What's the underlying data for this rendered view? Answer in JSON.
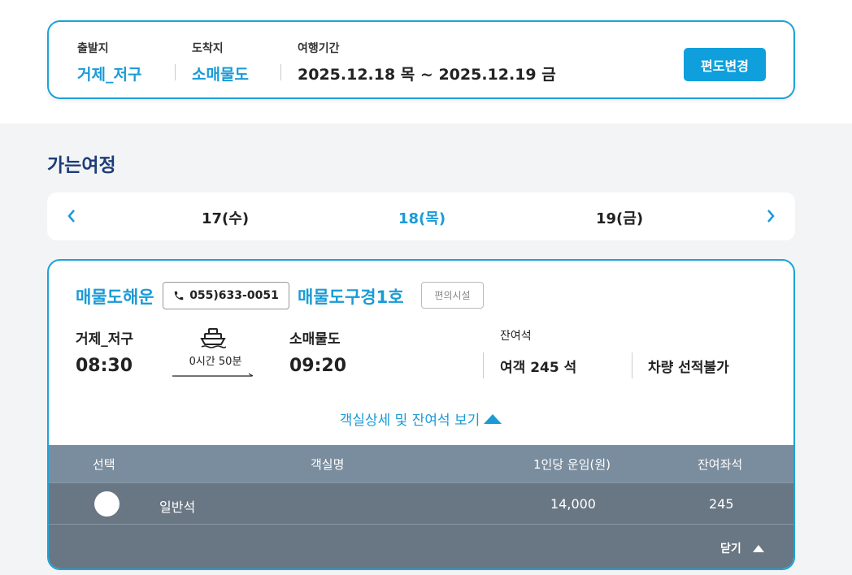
{
  "search": {
    "departure_label": "출발지",
    "departure_value": "거제_저구",
    "arrival_label": "도착지",
    "arrival_value": "소매물도",
    "period_label": "여행기간",
    "period_value": "2025.12.18 목 ~ 2025.12.19 금",
    "change_button": "편도변경"
  },
  "section_title": "가는여정",
  "dates": [
    {
      "label": "17(수)",
      "active": false
    },
    {
      "label": "18(목)",
      "active": true
    },
    {
      "label": "19(금)",
      "active": false
    }
  ],
  "voyage": {
    "company": "매물도해운",
    "phone": "055)633-0051",
    "ship_name": "매물도구경1호",
    "amenity_button": "편의시설",
    "origin_port": "거제_저구",
    "departure_time": "08:30",
    "duration": "0시간 50분",
    "destination_port": "소매물도",
    "arrival_time": "09:20",
    "seats_label": "잔여석",
    "passenger_seats": "여객 245 석",
    "vehicle_seats": "차량 선적불가",
    "detail_toggle": "객실상세 및 잔여석 보기"
  },
  "cabin_table": {
    "headers": [
      "선택",
      "객실명",
      "1인당 운임(원)",
      "잔여좌석"
    ],
    "rows": [
      {
        "name": "일반석",
        "fare": "14,000",
        "remaining": "245"
      }
    ],
    "close_label": "닫기"
  },
  "colors": {
    "accent": "#1a9bd7",
    "title": "#1d3c78",
    "table_header": "#7a8d9e",
    "table_row": "#697684"
  }
}
